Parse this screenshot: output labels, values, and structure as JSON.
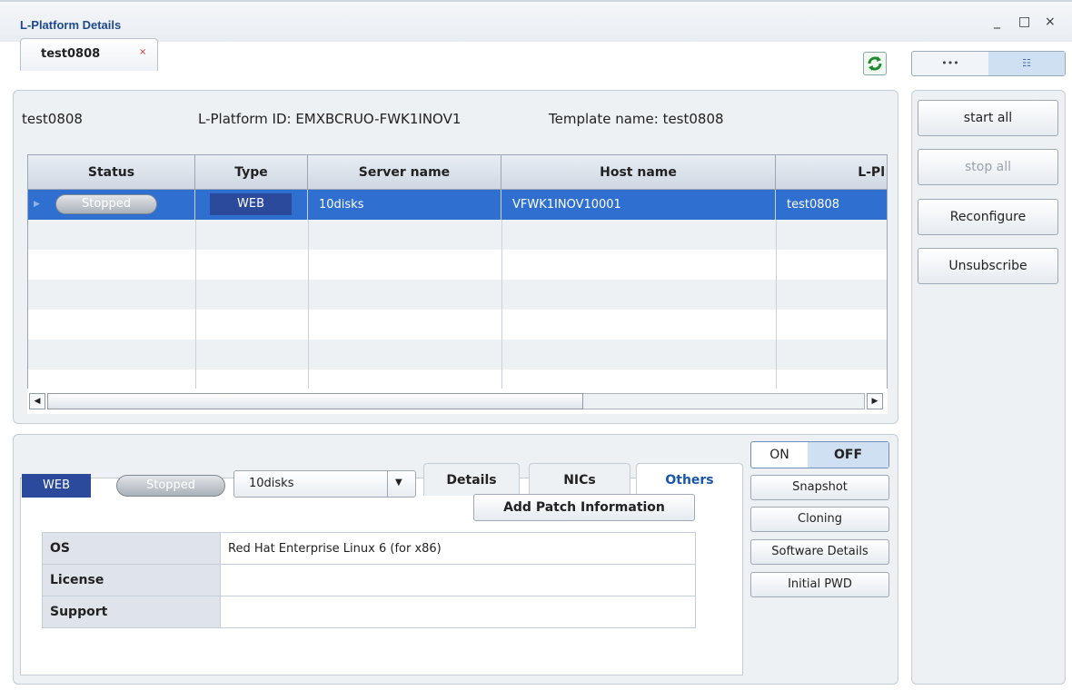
{
  "window": {
    "title": "L-Platform Details",
    "controls": [
      "_",
      "□",
      "×"
    ]
  },
  "doc_tab": {
    "label": "test0808",
    "close": "×"
  },
  "view_toggle": {
    "left": "•••",
    "right": "☷"
  },
  "summary": {
    "name": "test0808",
    "platform_id": "L-Platform ID: EMXBCRUO-FWK1INOV1",
    "template": "Template name: test0808"
  },
  "grid": {
    "columns": [
      "Status",
      "Type",
      "Server name",
      "Host name",
      "L-Pl"
    ],
    "rows": [
      {
        "status": "Stopped",
        "type": "WEB",
        "server": "10disks",
        "host": "VFWK1INOV10001",
        "lplatform": "test0808"
      }
    ]
  },
  "side_actions": {
    "start_all": "start all",
    "stop_all": "stop all",
    "reconfigure": "Reconfigure",
    "unsubscribe": "Unsubscribe"
  },
  "detail": {
    "type": "WEB",
    "status": "Stopped",
    "server_select": "10disks",
    "tabs": [
      "Details",
      "NICs",
      "Others"
    ],
    "active_tab": "Others",
    "add_patch": "Add Patch Information",
    "rows": [
      {
        "key": "OS",
        "value": "Red Hat Enterprise Linux 6 (for x86)"
      },
      {
        "key": "License",
        "value": ""
      },
      {
        "key": "Support",
        "value": ""
      }
    ]
  },
  "power": {
    "on": "ON",
    "off": "OFF"
  },
  "mini_actions": {
    "snapshot": "Snapshot",
    "cloning": "Cloning",
    "software_details": "Software Details",
    "initial_pwd": "Initial PWD"
  }
}
